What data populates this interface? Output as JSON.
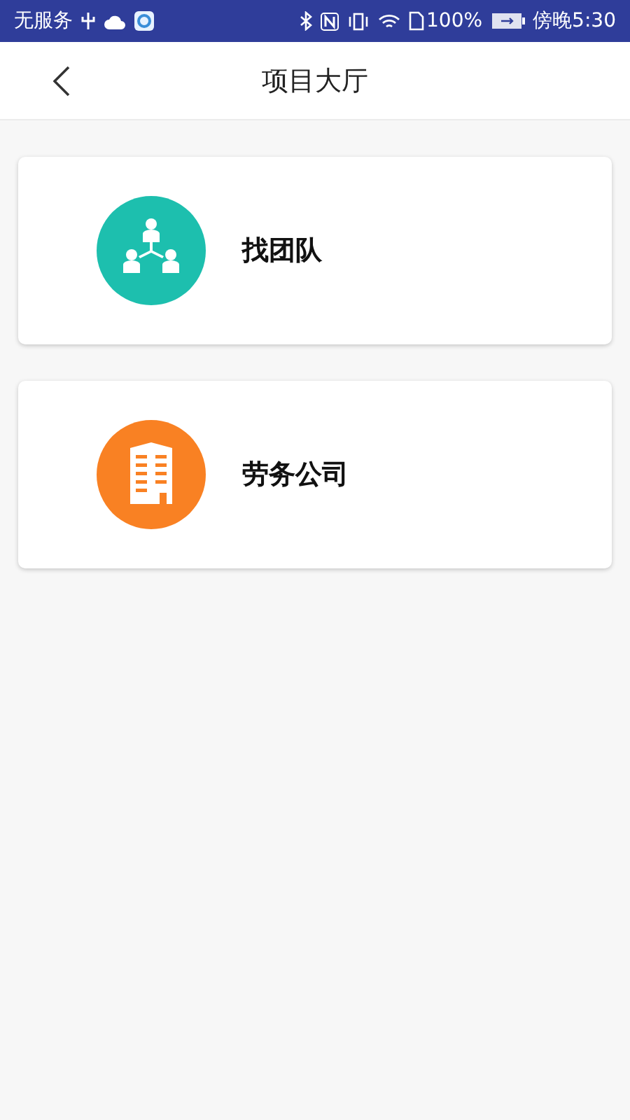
{
  "status_bar": {
    "carrier": "无服务",
    "battery": "100%",
    "time": "傍晚5:30"
  },
  "header": {
    "title": "项目大厅"
  },
  "cards": [
    {
      "label": "找团队",
      "kind": "team",
      "color": "#1dbfae"
    },
    {
      "label": "劳务公司",
      "kind": "building",
      "color": "#f98123"
    }
  ]
}
